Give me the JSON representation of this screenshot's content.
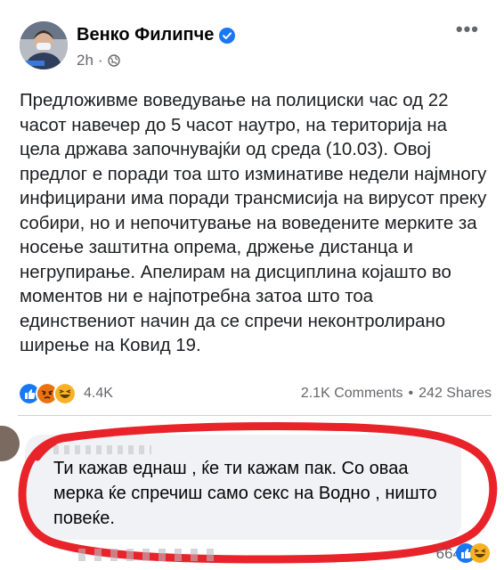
{
  "post": {
    "author": "Венко Филипче",
    "time": "2h",
    "dot": "·",
    "text": "Предложивме воведување на полициски час од 22 часот навечер до 5 часот наутро, на територија на цела држава започнувајќи од среда (10.03). Овој предлог е поради тоа што изминативе недели најмногу инфицирани има поради трансмисија на вирусот преку собири, но и непочитување на воведените мерките за носење заштитна опрема, држење дистанца и негрупирање. Апелирам на дисциплина којашто во моментов ни е најпотребна затоа што тоа единствениот начин да се спречи неконтролирано ширење на Ковид 19.",
    "reactions_count": "4.4K",
    "comments": "2.1K Comments",
    "shares": "242 Shares",
    "separator": "•"
  },
  "comment": {
    "text": "Ти кажав еднаш , ќе ти кажам пак. Со оваа мерка ќе спречиш само секс на Водно , ништо повеќе.",
    "reactions_count": "664"
  },
  "colors": {
    "verified": "#1877f2",
    "annotation_ring": "#e8232a",
    "like": "#1877f2",
    "angry": "#e9710f",
    "haha": "#f7b125"
  },
  "icons": [
    "verified-icon",
    "globe-icon",
    "more-options-icon",
    "like-reaction-icon",
    "angry-reaction-icon",
    "haha-reaction-icon"
  ]
}
